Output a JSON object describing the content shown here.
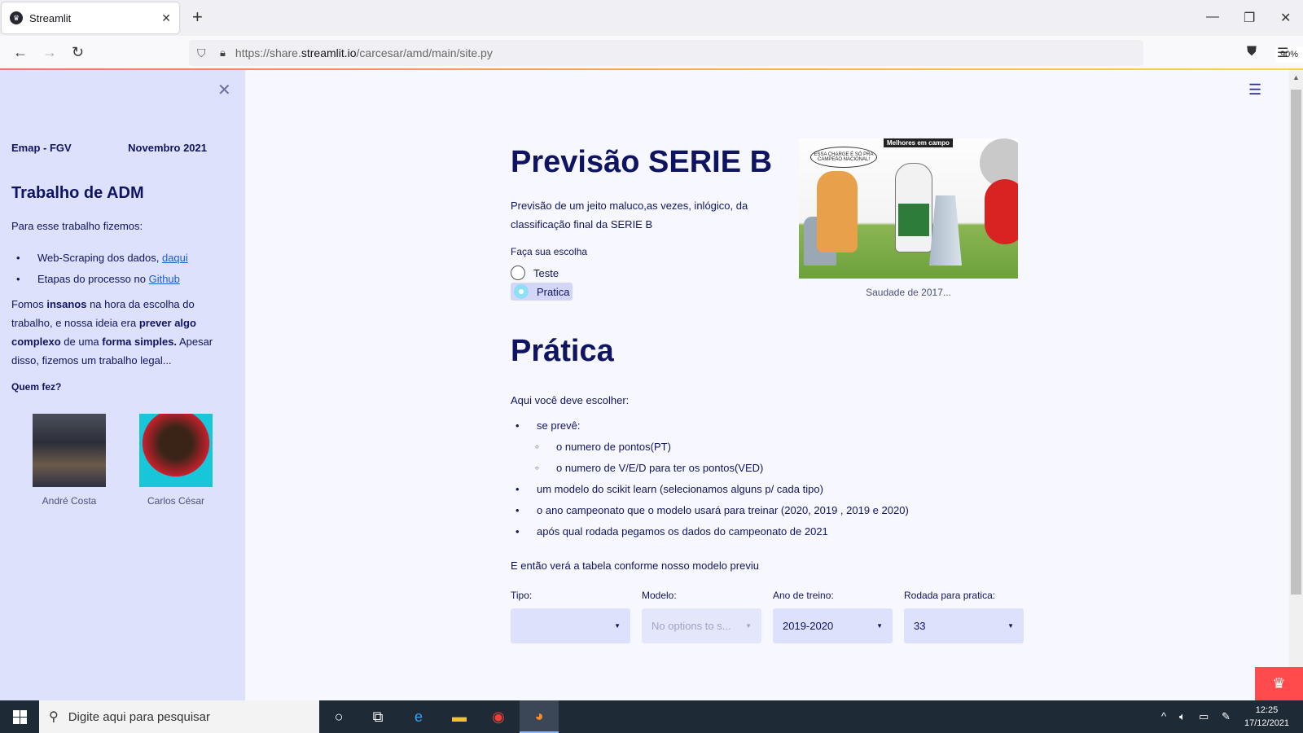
{
  "browser": {
    "tab_title": "Streamlit",
    "url_prefix": "https://share.",
    "url_domain": "streamlit.io",
    "url_path": "/carcesar/amd/main/site.py",
    "zoom": "90%"
  },
  "sidebar": {
    "org": "Emap - FGV",
    "date": "Novembro 2021",
    "heading": "Trabalho de ADM",
    "intro": "Para esse trabalho fizemos:",
    "items": [
      {
        "text": "Web-Scraping dos dados, ",
        "link": "daqui"
      },
      {
        "text": "Etapas do processo no ",
        "link": "Github"
      }
    ],
    "para": {
      "t1": "Fomos ",
      "b1": "insanos",
      "t2": " na hora da escolha do trabalho, e nossa ideia era ",
      "b2": "prever algo complexo",
      "t3": " de uma ",
      "b3": "forma simples.",
      "t4": " Apesar disso, fizemos um trabalho legal..."
    },
    "who_label": "Quem fez?",
    "authors": [
      "André Costa",
      "Carlos César"
    ]
  },
  "main": {
    "title": "Previsão SERIE B",
    "description": "Previsão de um jeito maluco,as vezes, inlógico, da classificação final da SERIE B",
    "choice_label": "Faça sua escolha",
    "options": [
      "Teste",
      "Pratica"
    ],
    "selected_option": "Pratica",
    "image_header": "Melhores em campo",
    "image_bubble": "ESSA CHARGE É SÓ PRA CAMPEÃO NACIONAL!",
    "image_caption": "Saudade de 2017...",
    "section_title": "Prática",
    "instruction": "Aqui você deve escolher:",
    "list": {
      "b1": "se prevê:",
      "s1": "o numero de pontos(PT)",
      "s2": "o numero de V/E/D para ter os pontos(VED)",
      "b2": "um modelo do scikit learn (selecionamos alguns p/ cada tipo)",
      "b3": "o ano campeonato que o modelo usará para treinar (2020, 2019 , 2019 e 2020)",
      "b4": "após qual rodada pegamos os dados do campeonato de 2021"
    },
    "closing": "E então verá a tabela conforme nosso modelo previu",
    "selects": [
      {
        "label": "Tipo:",
        "value": ""
      },
      {
        "label": "Modelo:",
        "value": "No options to s..."
      },
      {
        "label": "Ano de treino:",
        "value": "2019-2020"
      },
      {
        "label": "Rodada para pratica:",
        "value": "33"
      }
    ]
  },
  "taskbar": {
    "search_placeholder": "Digite aqui para pesquisar",
    "time": "12:25",
    "date": "17/12/2021"
  }
}
